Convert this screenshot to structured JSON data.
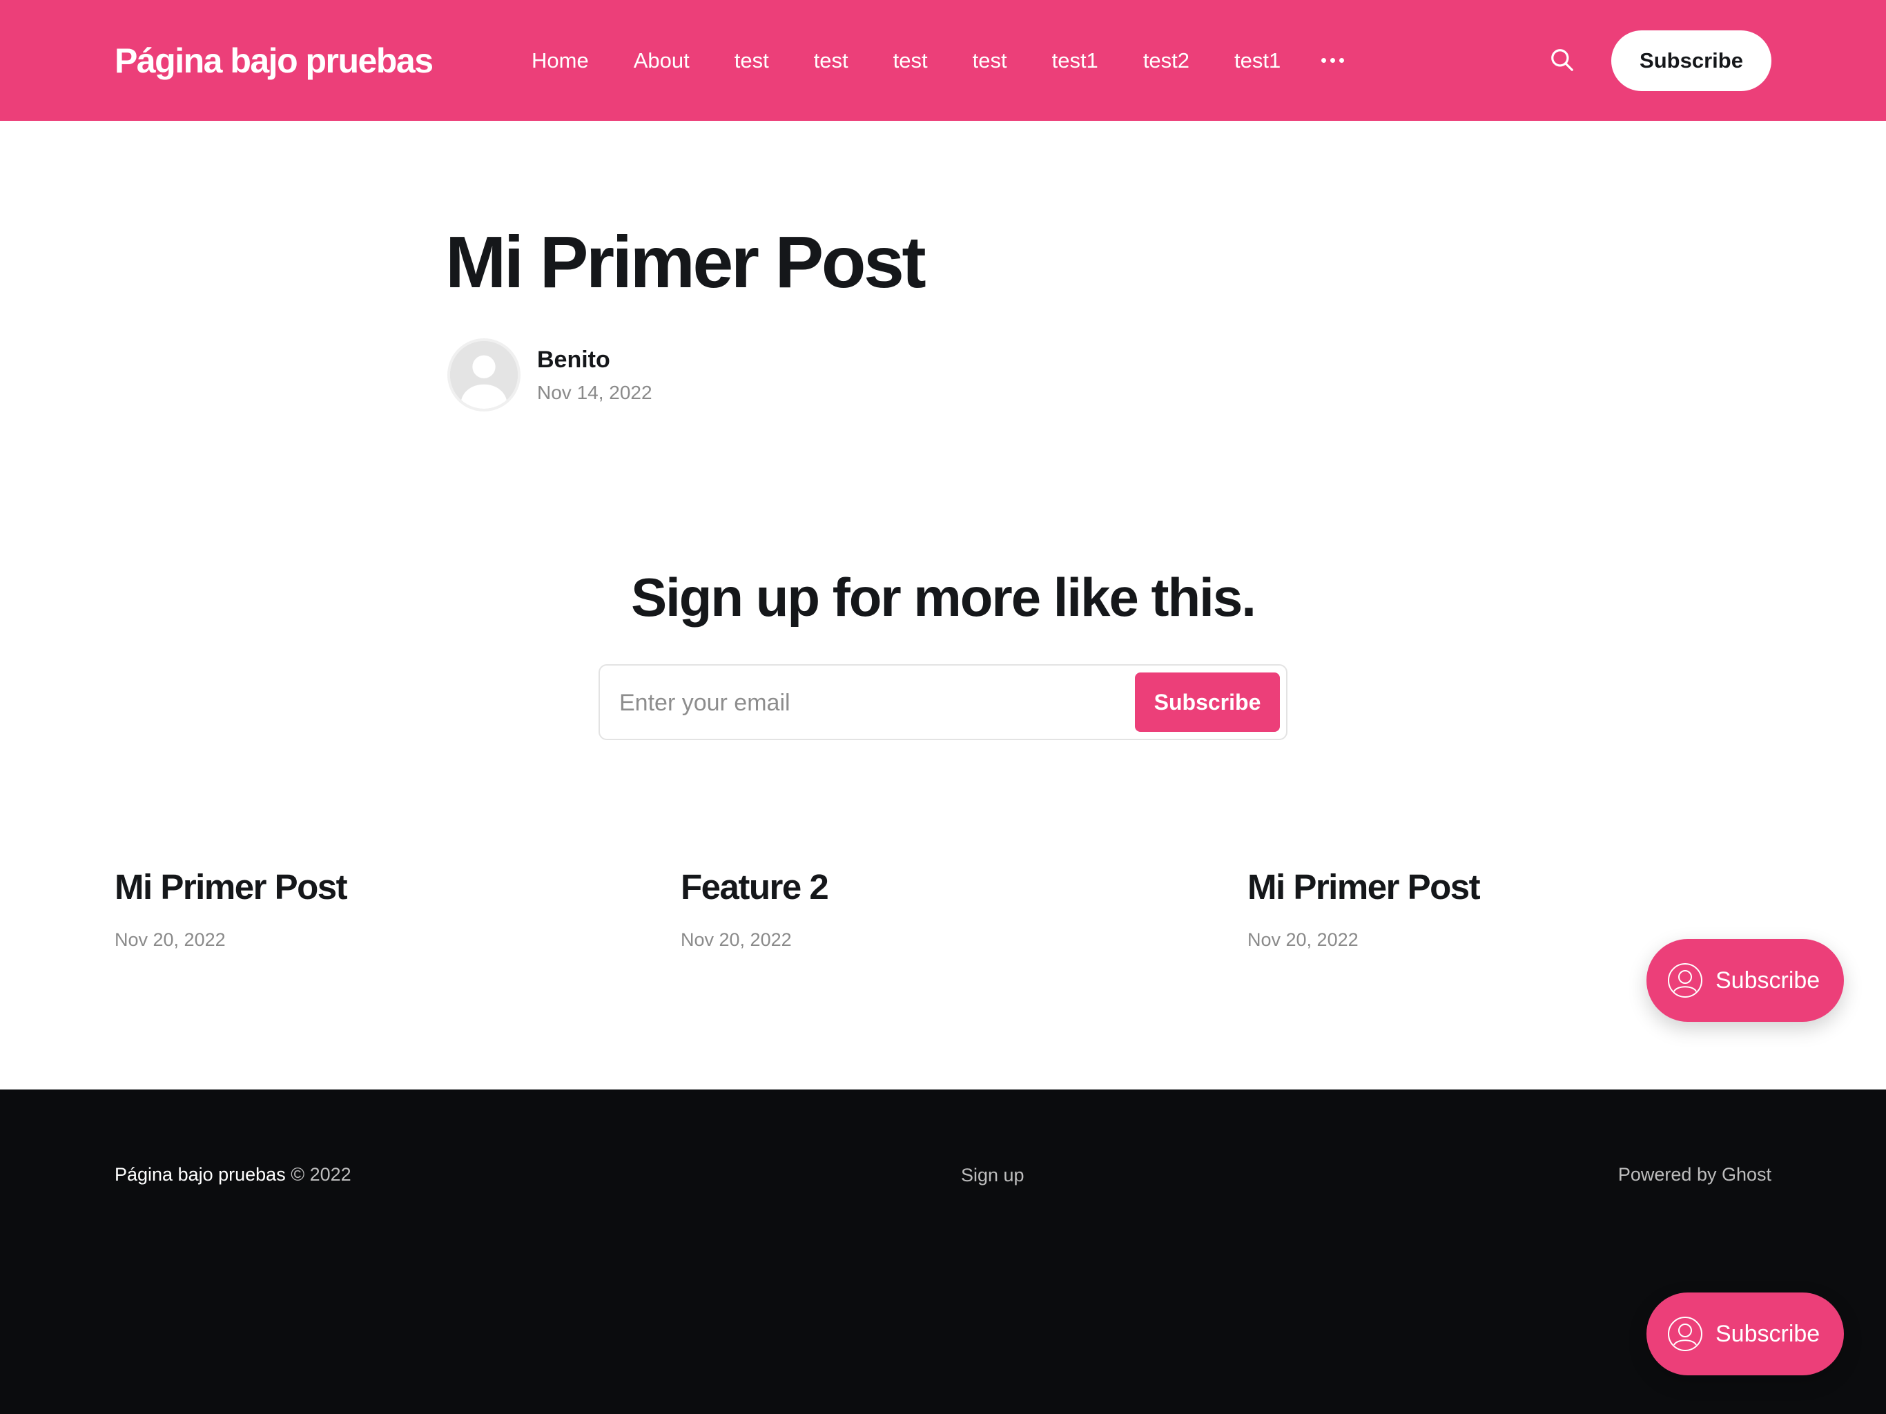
{
  "header": {
    "site_title": "Página bajo pruebas",
    "nav": [
      "Home",
      "About",
      "test",
      "test",
      "test",
      "test",
      "test1",
      "test2",
      "test1"
    ],
    "subscribe_label": "Subscribe"
  },
  "post": {
    "title": "Mi Primer Post",
    "author": "Benito",
    "date": "Nov 14, 2022"
  },
  "cta": {
    "title": "Sign up for more like this.",
    "email_placeholder": "Enter your email",
    "button_label": "Subscribe"
  },
  "related": [
    {
      "title": "Mi Primer Post",
      "date": "Nov 20, 2022"
    },
    {
      "title": "Feature 2",
      "date": "Nov 20, 2022"
    },
    {
      "title": "Mi Primer Post",
      "date": "Nov 20, 2022"
    }
  ],
  "footer": {
    "site_name": "Página bajo pruebas",
    "copyright": "© 2022",
    "signup_label": "Sign up",
    "powered_by": "Powered by Ghost"
  },
  "portal": {
    "label": "Subscribe"
  },
  "colors": {
    "accent": "#ec3f79",
    "footer_bg": "#0b0c0e",
    "text": "#15171a"
  }
}
